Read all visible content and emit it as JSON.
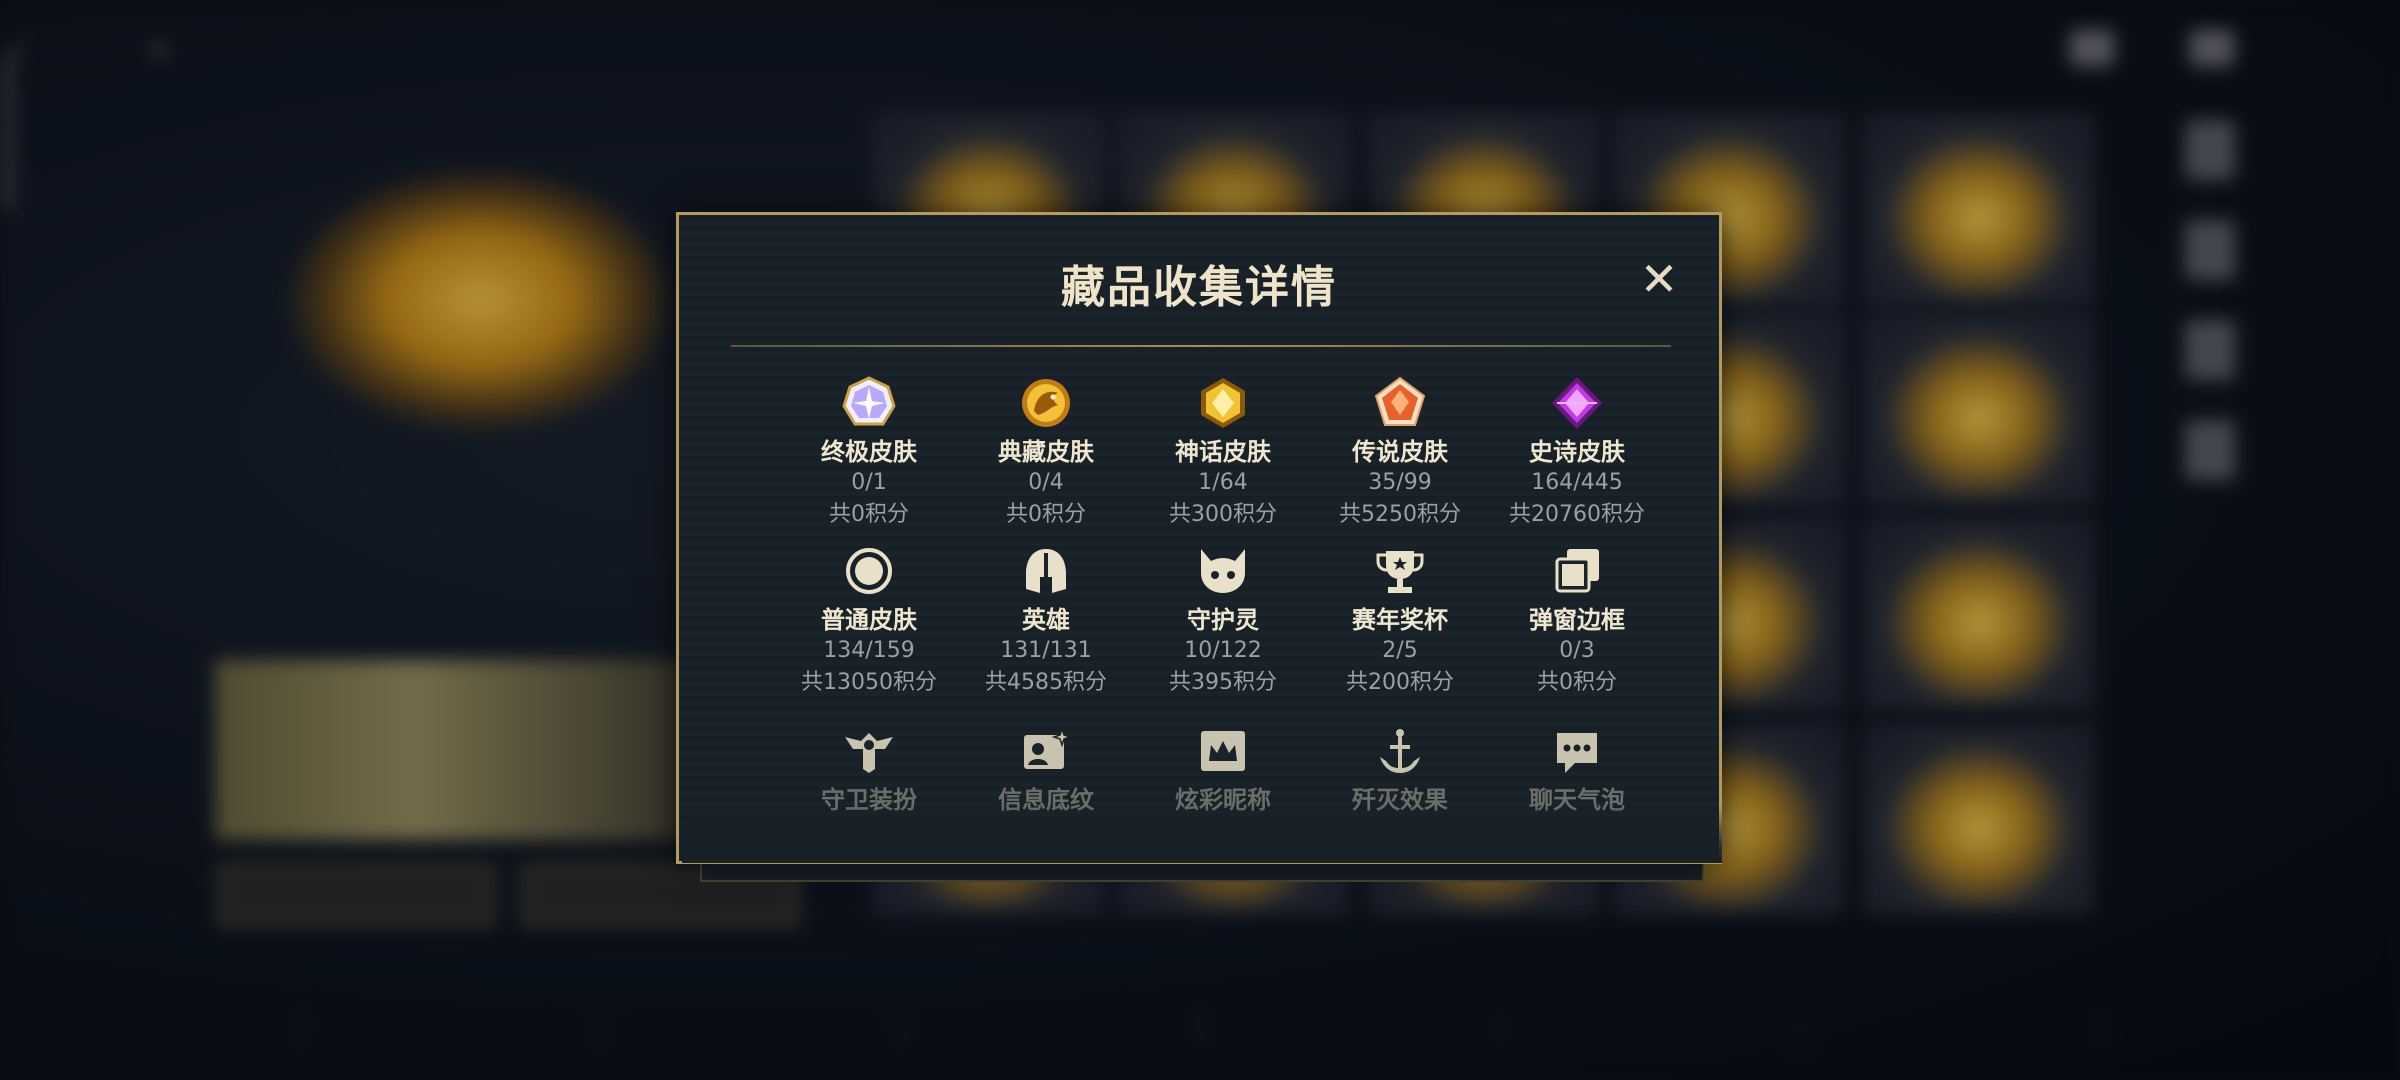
{
  "modal": {
    "title": "藏品收集详情",
    "close_label": "✕"
  },
  "rows": [
    [
      {
        "name": "终极皮肤",
        "count": "0/1",
        "points": "共0积分",
        "icon": "ultimate-skin-icon",
        "color": "#b9a8ff"
      },
      {
        "name": "典藏皮肤",
        "count": "0/4",
        "points": "共0积分",
        "icon": "dragon-collection-skin-icon",
        "color": "#e0a12a"
      },
      {
        "name": "神话皮肤",
        "count": "1/64",
        "points": "共300积分",
        "icon": "myth-skin-icon",
        "color": "#f2c230"
      },
      {
        "name": "传说皮肤",
        "count": "35/99",
        "points": "共5250积分",
        "icon": "legend-skin-icon",
        "color": "#e8602a"
      },
      {
        "name": "史诗皮肤",
        "count": "164/445",
        "points": "共20760积分",
        "icon": "epic-skin-icon",
        "color": "#b02fd8"
      }
    ],
    [
      {
        "name": "普通皮肤",
        "count": "134/159",
        "points": "共13050积分",
        "icon": "normal-skin-icon",
        "color": "#e8e0c8"
      },
      {
        "name": "英雄",
        "count": "131/131",
        "points": "共4585积分",
        "icon": "helmet-icon",
        "color": "#e8e0c8"
      },
      {
        "name": "守护灵",
        "count": "10/122",
        "points": "共395积分",
        "icon": "guardian-spirit-icon",
        "color": "#e8e0c8"
      },
      {
        "name": "赛年奖杯",
        "count": "2/5",
        "points": "共200积分",
        "icon": "trophy-icon",
        "color": "#e8e0c8"
      },
      {
        "name": "弹窗边框",
        "count": "0/3",
        "points": "共0积分",
        "icon": "popup-frame-icon",
        "color": "#e8e0c8"
      }
    ],
    [
      {
        "name": "守卫装扮",
        "icon": "guard-outfit-icon",
        "color": "#e8e0c8"
      },
      {
        "name": "信息底纹",
        "icon": "info-background-icon",
        "color": "#e8e0c8"
      },
      {
        "name": "炫彩昵称",
        "icon": "colorful-nickname-icon",
        "color": "#e8e0c8"
      },
      {
        "name": "歼灭效果",
        "icon": "annihilation-effect-icon",
        "color": "#e8e0c8"
      },
      {
        "name": "聊天气泡",
        "icon": "chat-bubble-icon",
        "color": "#e8e0c8"
      }
    ]
  ]
}
